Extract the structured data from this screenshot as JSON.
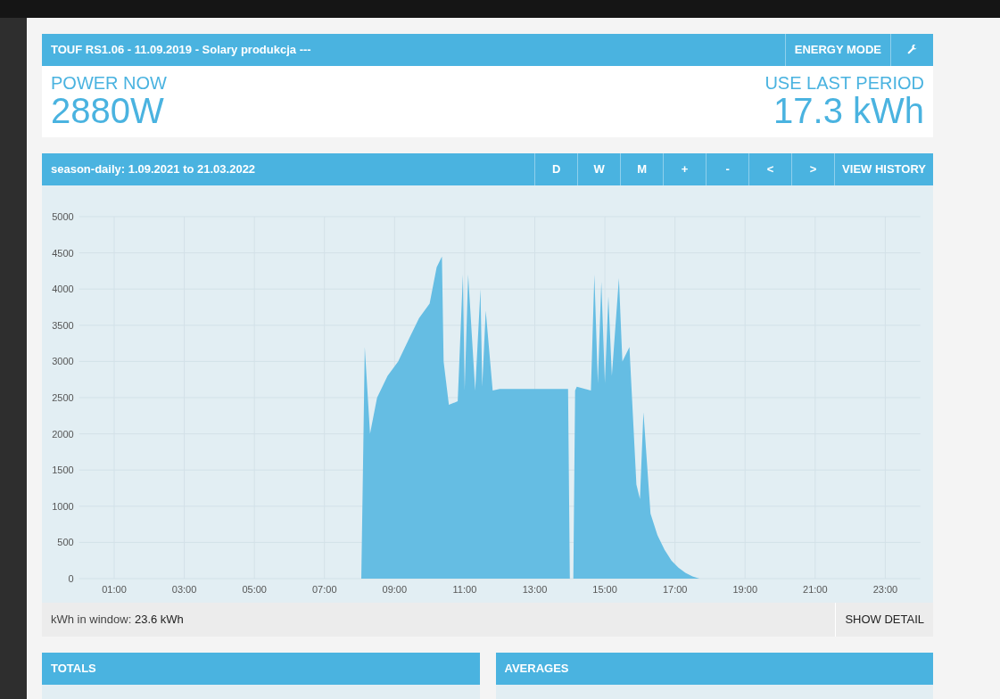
{
  "device_panel": {
    "title": "TOUF RS1.06 - 11.09.2019 - Solary produkcja ---",
    "mode_button": "ENERGY MODE",
    "power_now": {
      "label": "POWER NOW",
      "value": "2880W"
    },
    "use_last_period": {
      "label": "USE LAST PERIOD",
      "value": "17.3 kWh"
    }
  },
  "history_panel": {
    "title": "season-daily: 1.09.2021 to 21.03.2022",
    "buttons": [
      "D",
      "W",
      "M",
      "+",
      "-",
      "<",
      ">"
    ],
    "view_history": "VIEW HISTORY",
    "chart_data": {
      "type": "area",
      "x": [
        0,
        8.05,
        8.1,
        8.15,
        8.3,
        8.5,
        8.8,
        9.1,
        9.4,
        9.7,
        10.0,
        10.2,
        10.35,
        10.4,
        10.55,
        10.8,
        10.95,
        11.0,
        11.1,
        11.3,
        11.45,
        11.5,
        11.6,
        11.8,
        12.0,
        12.5,
        13.0,
        13.5,
        13.95,
        14.0,
        14.1,
        14.15,
        14.2,
        14.6,
        14.7,
        14.8,
        14.9,
        15.0,
        15.1,
        15.2,
        15.4,
        15.5,
        15.7,
        15.9,
        16.0,
        16.1,
        16.3,
        16.5,
        16.7,
        16.9,
        17.1,
        17.3,
        17.5,
        17.7,
        17.8,
        24
      ],
      "grid": true,
      "series": [
        {
          "color": "#65bde3",
          "values": [
            0,
            0,
            1600,
            3200,
            2000,
            2500,
            2800,
            3000,
            3300,
            3600,
            3800,
            4300,
            4450,
            3000,
            2400,
            2450,
            4200,
            2600,
            4200,
            2600,
            4000,
            2650,
            3700,
            2600,
            2620,
            2620,
            2620,
            2620,
            2620,
            0,
            0,
            2600,
            2650,
            2600,
            4200,
            2700,
            4100,
            2700,
            3900,
            2800,
            4150,
            3000,
            3200,
            1300,
            1100,
            2300,
            900,
            600,
            400,
            250,
            150,
            80,
            30,
            0,
            0,
            0
          ]
        }
      ],
      "xlim": [
        0,
        24
      ],
      "ylim": [
        0,
        5000
      ],
      "xticks": [
        {
          "value": 1,
          "label": "01:00"
        },
        {
          "value": 3,
          "label": "03:00"
        },
        {
          "value": 5,
          "label": "05:00"
        },
        {
          "value": 7,
          "label": "07:00"
        },
        {
          "value": 9,
          "label": "09:00"
        },
        {
          "value": 11,
          "label": "11:00"
        },
        {
          "value": 13,
          "label": "13:00"
        },
        {
          "value": 15,
          "label": "15:00"
        },
        {
          "value": 17,
          "label": "17:00"
        },
        {
          "value": 19,
          "label": "19:00"
        },
        {
          "value": 21,
          "label": "21:00"
        },
        {
          "value": 23,
          "label": "23:00"
        }
      ],
      "yticks": [
        0,
        500,
        1000,
        1500,
        2000,
        2500,
        3000,
        3500,
        4000,
        4500,
        5000
      ]
    },
    "kwh_label": "kWh in window:",
    "kwh_value": "23.6 kWh",
    "show_detail": "SHOW DETAIL"
  },
  "bottom_panels": [
    {
      "title": "TOTALS"
    },
    {
      "title": "AVERAGES"
    }
  ]
}
